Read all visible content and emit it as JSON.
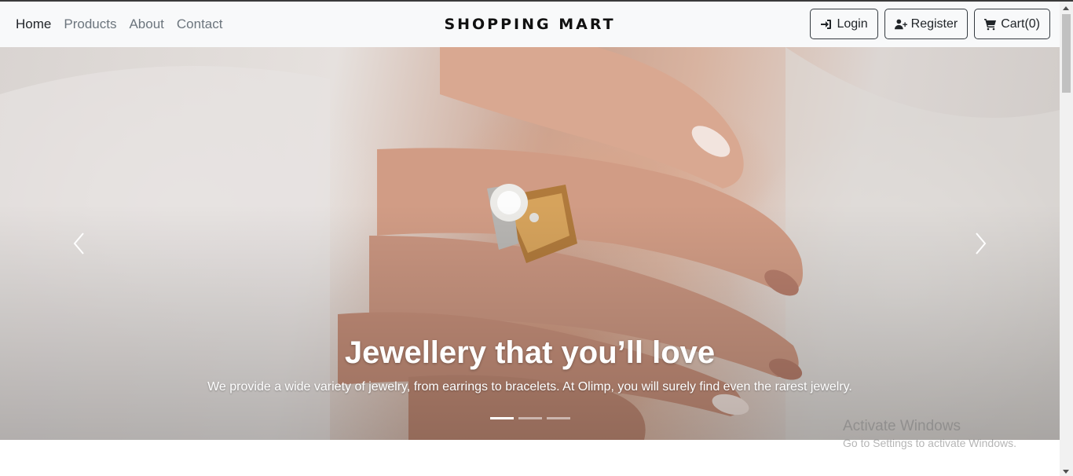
{
  "navbar": {
    "links": [
      "Home",
      "Products",
      "About",
      "Contact"
    ],
    "brand": "SHOPPING MART",
    "login_label": "Login",
    "register_label": "Register",
    "cart_label": "Cart(0)"
  },
  "carousel": {
    "title": "Jewellery that you’ll love",
    "text": "We provide a wide variety of jewelry, from earrings to bracelets. At Olimp, you will surely find even the rarest jewelry.",
    "slide_count": 3,
    "active_slide": 1,
    "prev_icon": "chevron-left-icon",
    "next_icon": "chevron-right-icon"
  },
  "watermark": {
    "title": "Activate Windows",
    "subtitle": "Go to Settings to activate Windows."
  },
  "colors": {
    "navbar_bg": "#f8f9fa",
    "text_dark": "#212529",
    "nav_muted": "#6c757d",
    "button_border": "#343a40"
  }
}
